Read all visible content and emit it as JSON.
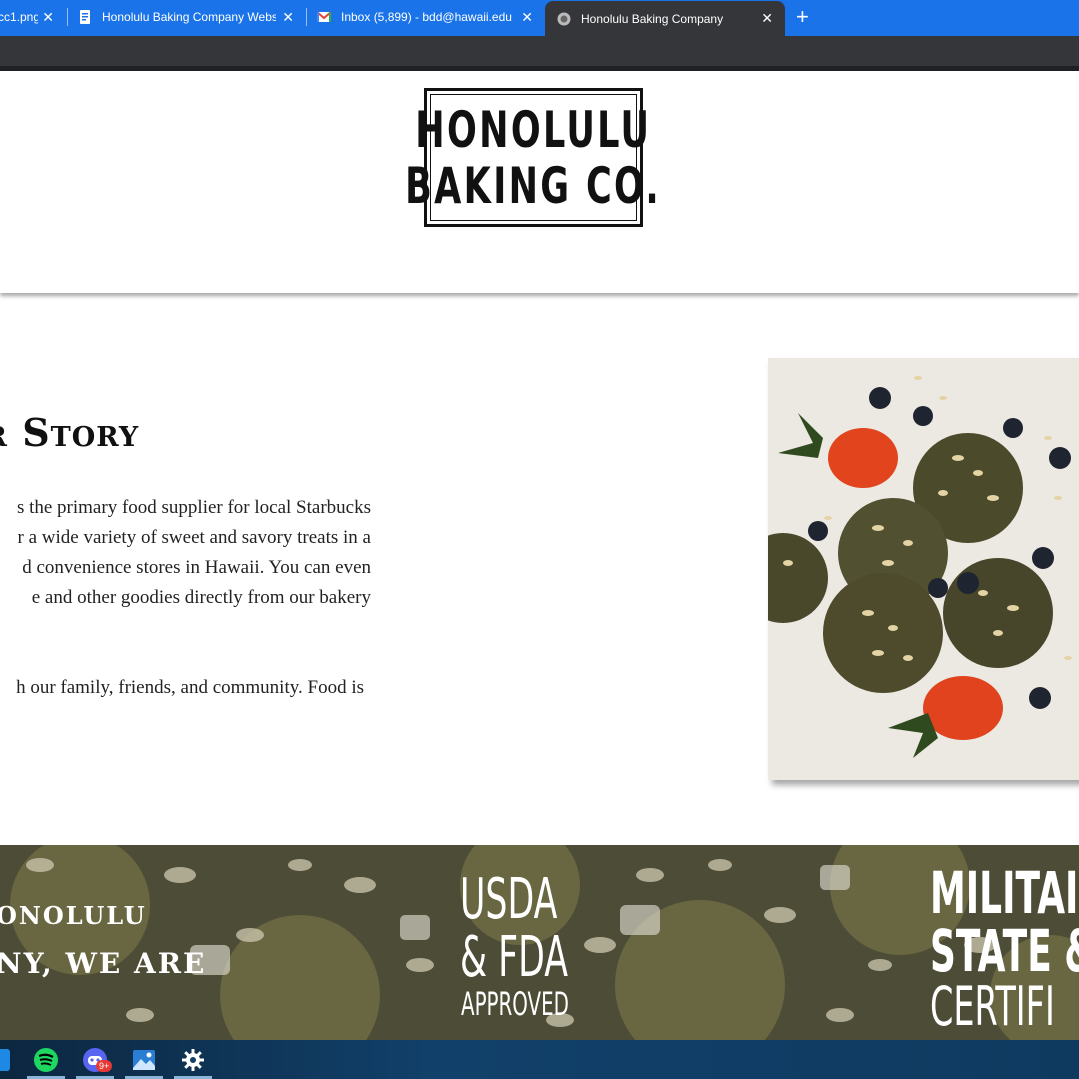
{
  "browser": {
    "tabs": [
      {
        "title": "cc1.png",
        "active": false
      },
      {
        "title": "Honolulu Baking Company Webs",
        "active": false
      },
      {
        "title": "Inbox (5,899) - bdd@hawaii.edu",
        "active": false
      },
      {
        "title": "Honolulu Baking Company",
        "active": true
      }
    ],
    "close_glyph": "✕",
    "new_tab_glyph": "+"
  },
  "site": {
    "logo": {
      "line1": "HONOLULU",
      "line2": "BAKING CO."
    },
    "story": {
      "heading": "ur Story",
      "paragraph1": [
        "s the primary food supplier for local Starbucks",
        "r a wide variety of sweet and savory treats in a",
        "d convenience stores in Hawaii. You can even",
        "e and other goodies directly from our bakery"
      ],
      "paragraph2": [
        "h our family, friends, and community. Food is"
      ],
      "photo_alt": "oat-topped muffins with strawberries and blueberries"
    },
    "banner": {
      "left_line1": "ONOLULU",
      "left_line2": "NY, WE ARE",
      "usda_line1": "USDA",
      "usda_line2": "& FDA",
      "usda_line3": "APPROVED",
      "military_line1": "MILITAI",
      "military_line2": "STATE &",
      "military_line3": "CERTIFI"
    }
  },
  "taskbar": {
    "icons": [
      "app-icon",
      "spotify-icon",
      "discord-icon",
      "photos-icon",
      "settings-icon"
    ],
    "discord_badge": "9+"
  }
}
